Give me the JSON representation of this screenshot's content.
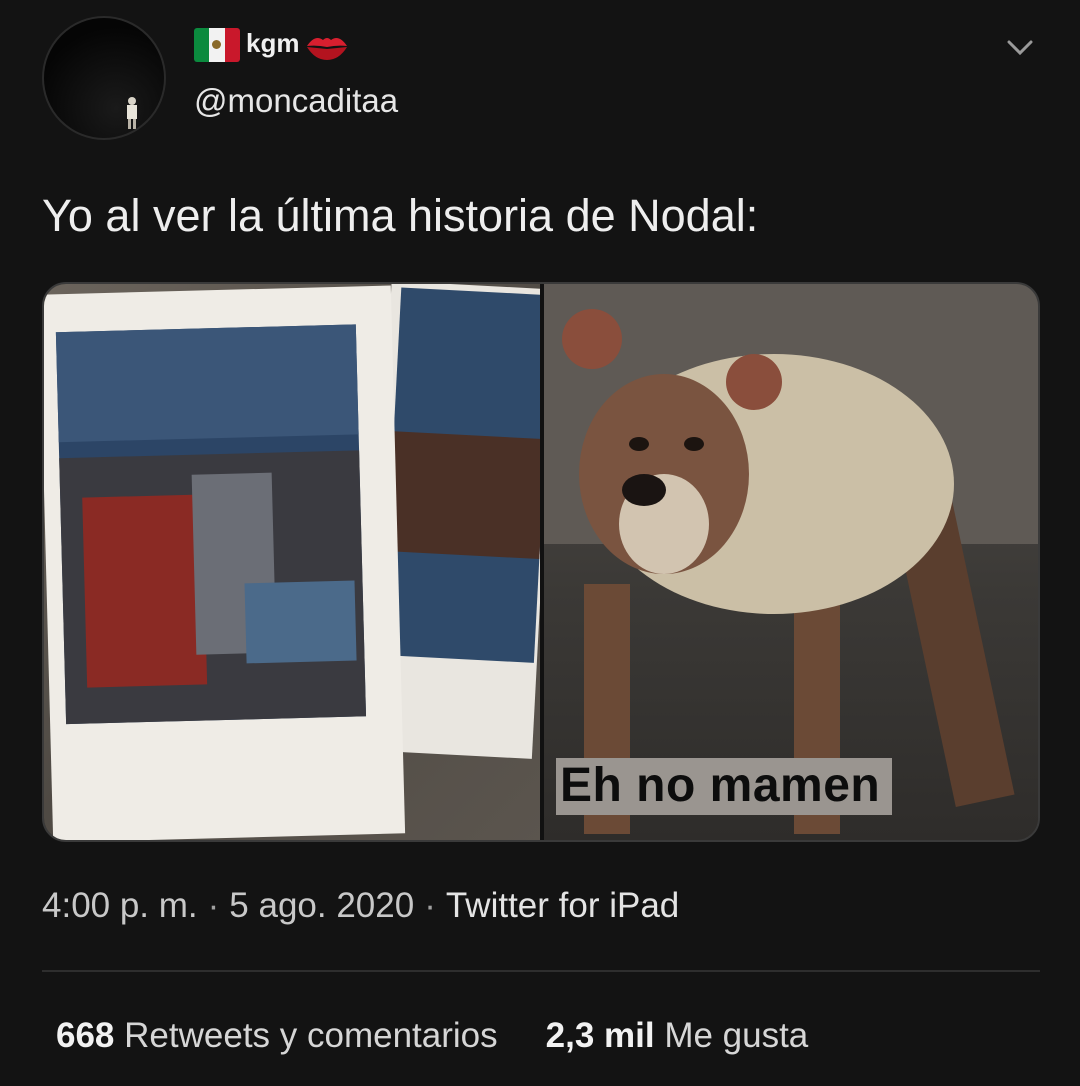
{
  "user": {
    "display_name": "kgm",
    "handle": "@moncaditaa",
    "flag_icon": "mexico-flag-icon",
    "emoji_icon": "lips-kiss-icon"
  },
  "tweet": {
    "text": "Yo al ver la última historia de Nodal:",
    "media_caption": "Eh no mamen",
    "time": "4:00 p. m.",
    "date": "5 ago. 2020",
    "source": "Twitter for iPad",
    "separator": "·"
  },
  "stats": {
    "retweets_count": "668",
    "retweets_label": "Retweets y comentarios",
    "likes_count": "2,3 mil",
    "likes_label": "Me gusta"
  },
  "colors": {
    "background": "#131313",
    "text": "#e8e8e8",
    "secondary_text": "#c8c8c8",
    "divider": "#2e2e2e"
  }
}
